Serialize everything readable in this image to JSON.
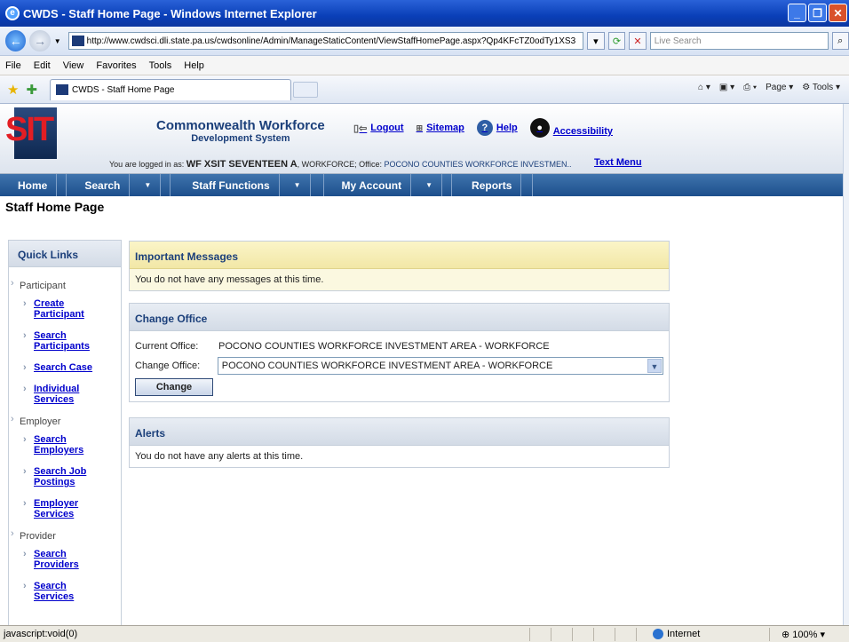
{
  "window": {
    "title": "CWDS - Staff Home Page - Windows Internet Explorer"
  },
  "addressbar": {
    "url": "http://www.cwdsci.dli.state.pa.us/cwdsonline/Admin/ManageStaticContent/ViewStaffHomePage.aspx?Qp4KFcTZ0odTy1XS3",
    "search_placeholder": "Live Search"
  },
  "menubar": [
    "File",
    "Edit",
    "View",
    "Favorites",
    "Tools",
    "Help"
  ],
  "tab": {
    "label": "CWDS - Staff Home Page"
  },
  "commandbar": {
    "page": "Page",
    "tools": "Tools"
  },
  "site": {
    "logo_text": "SIT",
    "system_name": "Commonwealth Workforce",
    "system_subname": "Development System",
    "links": {
      "logout": "Logout",
      "sitemap": "Sitemap",
      "help": "Help",
      "accessibility": "Accessibility"
    },
    "logged_in_prefix": "You are logged in as:",
    "user": "WF XSIT SEVENTEEN A",
    "role_office": ", WORKFORCE; Office:",
    "office": "POCONO COUNTIES WORKFORCE INVESTMEN..",
    "text_menu": "Text Menu"
  },
  "nav": [
    {
      "label": "Home",
      "dropdown": false
    },
    {
      "label": "Search",
      "dropdown": true
    },
    {
      "label": "Staff Functions",
      "dropdown": true
    },
    {
      "label": "My Account",
      "dropdown": true
    },
    {
      "label": "Reports",
      "dropdown": false
    }
  ],
  "page_title": "Staff Home Page",
  "quick_links": {
    "title": "Quick Links",
    "sections": [
      {
        "label": "Participant",
        "links": [
          "Create Participant",
          "Search Participants",
          "Search Case",
          "Individual Services"
        ]
      },
      {
        "label": "Employer",
        "links": [
          "Search Employers",
          "Search Job Postings",
          "Employer Services"
        ]
      },
      {
        "label": "Provider",
        "links": [
          "Search Providers",
          "Search Services"
        ]
      }
    ]
  },
  "messages": {
    "title": "Important Messages",
    "text": "You do not have any messages at this time."
  },
  "change_office": {
    "title": "Change Office",
    "current_label": "Current Office:",
    "current_value": "POCONO COUNTIES WORKFORCE INVESTMENT AREA - WORKFORCE",
    "change_label": "Change Office:",
    "selected": "POCONO COUNTIES WORKFORCE INVESTMENT AREA - WORKFORCE",
    "button": "Change"
  },
  "alerts": {
    "title": "Alerts",
    "text": "You do not have any alerts at this time."
  },
  "statusbar": {
    "text": "javascript:void(0)",
    "zone": "Internet",
    "zoom": "100%"
  }
}
